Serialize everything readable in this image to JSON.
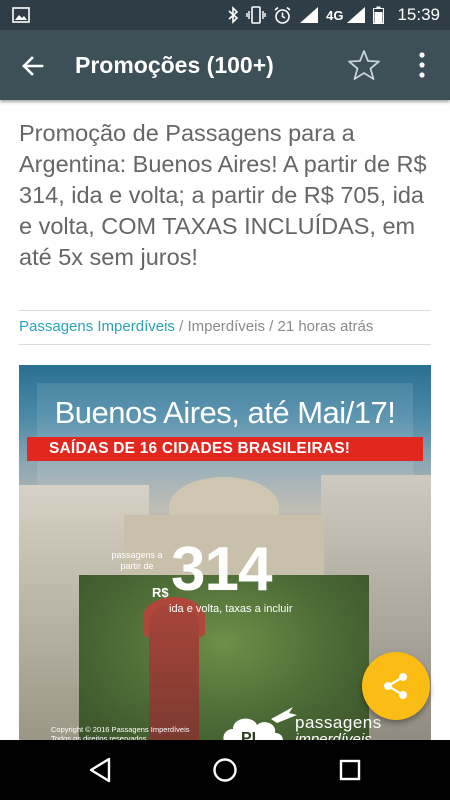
{
  "status_bar": {
    "network": "4G",
    "time": "15:39"
  },
  "app_bar": {
    "title": "Promoções (100+)"
  },
  "article": {
    "headline": "Promoção de Passagens para a Argentina: Buenos Aires! A partir de R$ 314, ida e volta; a partir de R$ 705, ida e volta, COM TAXAS INCLUÍDAS, em até 5x sem juros!",
    "source": "Passagens Imperdíveis",
    "separator": " / ",
    "category": "Imperdíveis",
    "time_ago": "21 horas atrás"
  },
  "promo_image": {
    "title": "Buenos Aires, até Mai/17!",
    "banner": "SAÍDAS DE 16 CIDADES BRASILEIRAS!",
    "price_label": "passagens a partir de",
    "currency": "R$",
    "price": "314",
    "price_note": "ida e volta, taxas a incluir",
    "copyright": "Copyright © 2016 Passagens Imperdíveis",
    "copyright_line2": "Todos os direitos reservados",
    "logo_text_1": "passagens",
    "logo_text_2": "imperdíveis"
  },
  "colors": {
    "app_bar": "#3d4f57",
    "status_bar": "#2f3e46",
    "link": "#2aa3b8",
    "fab": "#fbbd14",
    "banner": "#e2271f"
  },
  "icons": {
    "status_left": "image-icon",
    "status_right": [
      "bluetooth-icon",
      "vibrate-icon",
      "alarm-icon",
      "wifi-signal-icon",
      "cell-signal-icon",
      "battery-icon"
    ],
    "app_bar": [
      "back-arrow-icon",
      "star-outline-icon",
      "more-vertical-icon"
    ],
    "fab": "share-icon",
    "nav": [
      "nav-back-icon",
      "nav-home-icon",
      "nav-recents-icon"
    ]
  }
}
